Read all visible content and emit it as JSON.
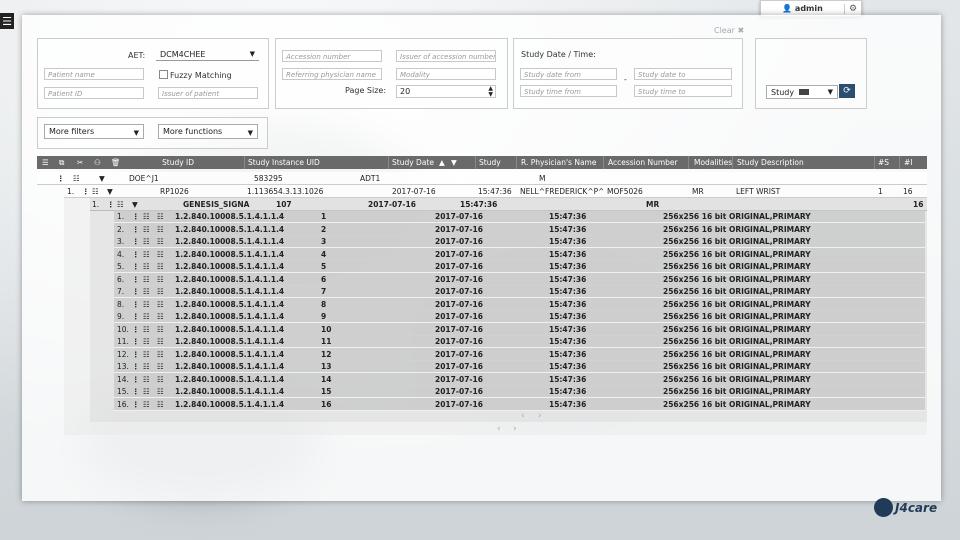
{
  "topbar": {
    "user": "admin"
  },
  "filters": {
    "clear_label": "Clear",
    "aet_label": "AET:",
    "aet_value": "DCM4CHEE",
    "patient_name_placeholder": "Patient name",
    "fuzzy_label": "Fuzzy Matching",
    "patient_id_placeholder": "Patient ID",
    "issuer_patient_placeholder": "Issuer of patient",
    "accession_placeholder": "Accession number",
    "issuer_accession_placeholder": "Issuer of accession number",
    "ref_physician_placeholder": "Referring physician name",
    "modality_placeholder": "Modality",
    "page_size_label": "Page Size:",
    "page_size_value": "20",
    "date_time_label": "Study Date / Time:",
    "date_from_placeholder": "Study date from",
    "date_to_placeholder": "Study date to",
    "time_from_placeholder": "Study time from",
    "time_to_placeholder": "Study time to",
    "date_dash": "-",
    "level_value": "Study",
    "more_filters": "More filters",
    "more_functions": "More functions"
  },
  "grid": {
    "headers": {
      "study_id": "Study ID",
      "study_uid": "Study Instance UID",
      "study_date": "Study Date",
      "study_time": "Study",
      "physician": "R. Physician's Name",
      "accession": "Accession Number",
      "modalities": "Modalities",
      "description": "Study Description",
      "series_count": "#S",
      "instance_count": "#I"
    },
    "patient": {
      "name": "DOE^J1",
      "id": "583295",
      "issuer": "ADT1",
      "sex": "M"
    },
    "study": {
      "index": "1.",
      "study_id": "RP1026",
      "uid": "1.113654.3.13.1026",
      "date": "2017-07-16",
      "time": "15:47:36",
      "physician": "NELL^FREDERICK^P^D",
      "accession": "MOF5026",
      "modality": "MR",
      "description": "LEFT WRIST",
      "series": "1",
      "instances": "16"
    },
    "series": {
      "index": "1.",
      "station": "GENESIS_SIGNA",
      "number": "107",
      "date": "2017-07-16",
      "time": "15:47:36",
      "modality": "MR",
      "instances": "16"
    },
    "instances": [
      {
        "idx": "1.",
        "sop": "1.2.840.10008.5.1.4.1.1.4",
        "num": "1",
        "date": "2017-07-16",
        "time": "15:47:36",
        "info": "256x256 16 bit ORIGINAL,PRIMARY"
      },
      {
        "idx": "2.",
        "sop": "1.2.840.10008.5.1.4.1.1.4",
        "num": "2",
        "date": "2017-07-16",
        "time": "15:47:36",
        "info": "256x256 16 bit ORIGINAL,PRIMARY"
      },
      {
        "idx": "3.",
        "sop": "1.2.840.10008.5.1.4.1.1.4",
        "num": "3",
        "date": "2017-07-16",
        "time": "15:47:36",
        "info": "256x256 16 bit ORIGINAL,PRIMARY"
      },
      {
        "idx": "4.",
        "sop": "1.2.840.10008.5.1.4.1.1.4",
        "num": "4",
        "date": "2017-07-16",
        "time": "15:47:36",
        "info": "256x256 16 bit ORIGINAL,PRIMARY"
      },
      {
        "idx": "5.",
        "sop": "1.2.840.10008.5.1.4.1.1.4",
        "num": "5",
        "date": "2017-07-16",
        "time": "15:47:36",
        "info": "256x256 16 bit ORIGINAL,PRIMARY"
      },
      {
        "idx": "6.",
        "sop": "1.2.840.10008.5.1.4.1.1.4",
        "num": "6",
        "date": "2017-07-16",
        "time": "15:47:36",
        "info": "256x256 16 bit ORIGINAL,PRIMARY"
      },
      {
        "idx": "7.",
        "sop": "1.2.840.10008.5.1.4.1.1.4",
        "num": "7",
        "date": "2017-07-16",
        "time": "15:47:36",
        "info": "256x256 16 bit ORIGINAL,PRIMARY"
      },
      {
        "idx": "8.",
        "sop": "1.2.840.10008.5.1.4.1.1.4",
        "num": "8",
        "date": "2017-07-16",
        "time": "15:47:36",
        "info": "256x256 16 bit ORIGINAL,PRIMARY"
      },
      {
        "idx": "9.",
        "sop": "1.2.840.10008.5.1.4.1.1.4",
        "num": "9",
        "date": "2017-07-16",
        "time": "15:47:36",
        "info": "256x256 16 bit ORIGINAL,PRIMARY"
      },
      {
        "idx": "10.",
        "sop": "1.2.840.10008.5.1.4.1.1.4",
        "num": "10",
        "date": "2017-07-16",
        "time": "15:47:36",
        "info": "256x256 16 bit ORIGINAL,PRIMARY"
      },
      {
        "idx": "11.",
        "sop": "1.2.840.10008.5.1.4.1.1.4",
        "num": "11",
        "date": "2017-07-16",
        "time": "15:47:36",
        "info": "256x256 16 bit ORIGINAL,PRIMARY"
      },
      {
        "idx": "12.",
        "sop": "1.2.840.10008.5.1.4.1.1.4",
        "num": "12",
        "date": "2017-07-16",
        "time": "15:47:36",
        "info": "256x256 16 bit ORIGINAL,PRIMARY"
      },
      {
        "idx": "13.",
        "sop": "1.2.840.10008.5.1.4.1.1.4",
        "num": "13",
        "date": "2017-07-16",
        "time": "15:47:36",
        "info": "256x256 16 bit ORIGINAL,PRIMARY"
      },
      {
        "idx": "14.",
        "sop": "1.2.840.10008.5.1.4.1.1.4",
        "num": "14",
        "date": "2017-07-16",
        "time": "15:47:36",
        "info": "256x256 16 bit ORIGINAL,PRIMARY"
      },
      {
        "idx": "15.",
        "sop": "1.2.840.10008.5.1.4.1.1.4",
        "num": "15",
        "date": "2017-07-16",
        "time": "15:47:36",
        "info": "256x256 16 bit ORIGINAL,PRIMARY"
      },
      {
        "idx": "16.",
        "sop": "1.2.840.10008.5.1.4.1.1.4",
        "num": "16",
        "date": "2017-07-16",
        "time": "15:47:36",
        "info": "256x256 16 bit ORIGINAL,PRIMARY"
      }
    ]
  },
  "branding": {
    "logo_text": "J4care",
    "accent": "#1f3b57"
  }
}
